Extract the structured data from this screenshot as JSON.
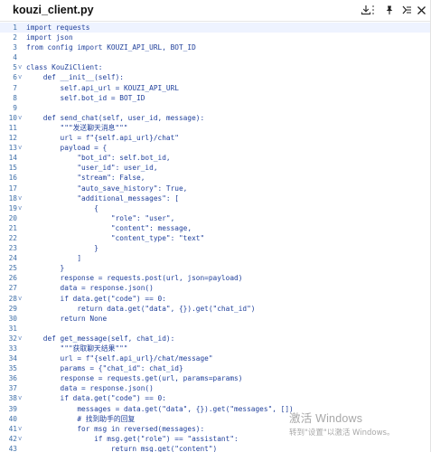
{
  "window": {
    "title": "kouzi_client.py",
    "icons": [
      "download-icon",
      "more-icon",
      "pin-icon",
      "close-icon"
    ]
  },
  "colors": {
    "code_text": "#1f3f9a",
    "line_number": "#3e6fa8",
    "highlight": "#eef3ff"
  },
  "code": {
    "lines": [
      {
        "n": "1",
        "fold": "",
        "text": "import requests"
      },
      {
        "n": "2",
        "fold": "",
        "text": "import json"
      },
      {
        "n": "3",
        "fold": "",
        "text": "from config import KOUZI_API_URL, BOT_ID"
      },
      {
        "n": "4",
        "fold": "",
        "text": ""
      },
      {
        "n": "5",
        "fold": "v",
        "text": "class KouZiClient:"
      },
      {
        "n": "6",
        "fold": "v",
        "text": "    def __init__(self):"
      },
      {
        "n": "7",
        "fold": "",
        "text": "        self.api_url = KOUZI_API_URL"
      },
      {
        "n": "8",
        "fold": "",
        "text": "        self.bot_id = BOT_ID"
      },
      {
        "n": "9",
        "fold": "",
        "text": ""
      },
      {
        "n": "10",
        "fold": "v",
        "text": "    def send_chat(self, user_id, message):"
      },
      {
        "n": "11",
        "fold": "",
        "text": "        \"\"\"发送聊天消息\"\"\""
      },
      {
        "n": "12",
        "fold": "",
        "text": "        url = f\"{self.api_url}/chat\""
      },
      {
        "n": "13",
        "fold": "v",
        "text": "        payload = {"
      },
      {
        "n": "14",
        "fold": "",
        "text": "            \"bot_id\": self.bot_id,"
      },
      {
        "n": "15",
        "fold": "",
        "text": "            \"user_id\": user_id,"
      },
      {
        "n": "16",
        "fold": "",
        "text": "            \"stream\": False,"
      },
      {
        "n": "17",
        "fold": "",
        "text": "            \"auto_save_history\": True,"
      },
      {
        "n": "18",
        "fold": "v",
        "text": "            \"additional_messages\": ["
      },
      {
        "n": "19",
        "fold": "v",
        "text": "                {"
      },
      {
        "n": "20",
        "fold": "",
        "text": "                    \"role\": \"user\","
      },
      {
        "n": "21",
        "fold": "",
        "text": "                    \"content\": message,"
      },
      {
        "n": "22",
        "fold": "",
        "text": "                    \"content_type\": \"text\""
      },
      {
        "n": "23",
        "fold": "",
        "text": "                }"
      },
      {
        "n": "24",
        "fold": "",
        "text": "            ]"
      },
      {
        "n": "25",
        "fold": "",
        "text": "        }"
      },
      {
        "n": "26",
        "fold": "",
        "text": "        response = requests.post(url, json=payload)"
      },
      {
        "n": "27",
        "fold": "",
        "text": "        data = response.json()"
      },
      {
        "n": "28",
        "fold": "v",
        "text": "        if data.get(\"code\") == 0:"
      },
      {
        "n": "29",
        "fold": "",
        "text": "            return data.get(\"data\", {}).get(\"chat_id\")"
      },
      {
        "n": "30",
        "fold": "",
        "text": "        return None"
      },
      {
        "n": "31",
        "fold": "",
        "text": ""
      },
      {
        "n": "32",
        "fold": "v",
        "text": "    def get_message(self, chat_id):"
      },
      {
        "n": "33",
        "fold": "",
        "text": "        \"\"\"获取聊天结果\"\"\""
      },
      {
        "n": "34",
        "fold": "",
        "text": "        url = f\"{self.api_url}/chat/message\""
      },
      {
        "n": "35",
        "fold": "",
        "text": "        params = {\"chat_id\": chat_id}"
      },
      {
        "n": "36",
        "fold": "",
        "text": "        response = requests.get(url, params=params)"
      },
      {
        "n": "37",
        "fold": "",
        "text": "        data = response.json()"
      },
      {
        "n": "38",
        "fold": "v",
        "text": "        if data.get(\"code\") == 0:"
      },
      {
        "n": "39",
        "fold": "",
        "text": "            messages = data.get(\"data\", {}).get(\"messages\", [])"
      },
      {
        "n": "40",
        "fold": "",
        "text": "            # 找到助手的回复"
      },
      {
        "n": "41",
        "fold": "v",
        "text": "            for msg in reversed(messages):"
      },
      {
        "n": "42",
        "fold": "v",
        "text": "                if msg.get(\"role\") == \"assistant\":"
      },
      {
        "n": "43",
        "fold": "",
        "text": "                    return msg.get(\"content\")"
      }
    ]
  },
  "watermark": {
    "title": "激活 Windows",
    "subtitle": "转到\"设置\"以激活 Windows。"
  }
}
